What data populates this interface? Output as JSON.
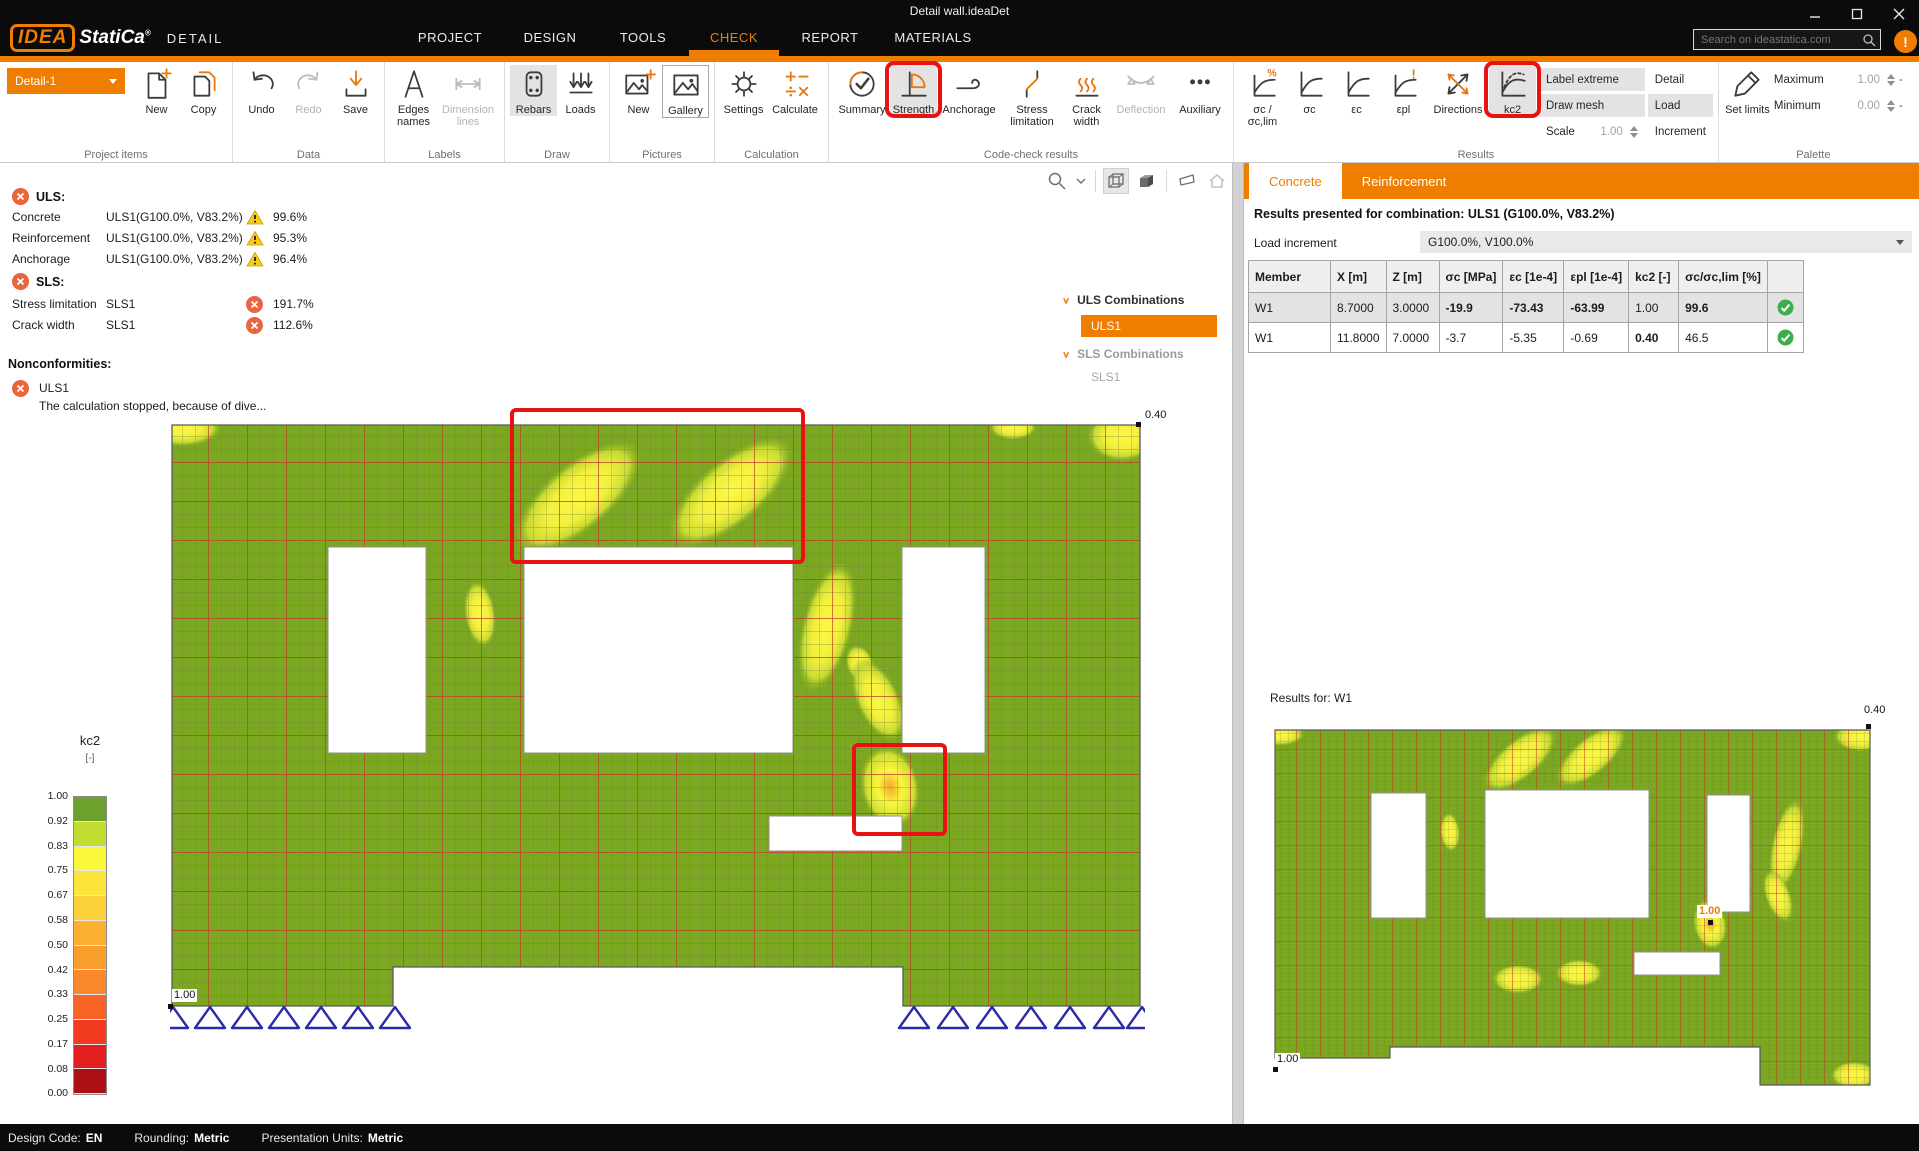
{
  "window": {
    "title": "Detail wall.ideaDet"
  },
  "appbar": {
    "logo_idea": "IDEA",
    "logo_statica": "StatiCa",
    "logo_reg": "®",
    "module": "DETAIL",
    "menus": [
      "PROJECT",
      "DESIGN",
      "TOOLS",
      "CHECK",
      "REPORT",
      "MATERIALS"
    ],
    "search_placeholder": "Search on ideastatica.com",
    "alert": "!"
  },
  "ribbon": {
    "project_combo": "Detail-1",
    "groups": [
      "Project items",
      "Data",
      "Labels",
      "Draw",
      "Pictures",
      "Calculation",
      "Code-check results",
      "Results",
      "Palette"
    ],
    "btn": {
      "new_item": "New",
      "copy": "Copy",
      "undo": "Undo",
      "redo": "Redo",
      "save": "Save",
      "edges_names": "Edges names",
      "dimension_lines": "Dimension lines",
      "rebars": "Rebars",
      "loads": "Loads",
      "new_picture": "New",
      "gallery": "Gallery",
      "settings": "Settings",
      "calculate": "Calculate",
      "summary": "Summary",
      "strength": "Strength",
      "anchorage": "Anchorage",
      "stress_limitation": "Stress limitation",
      "crack_width": "Crack width",
      "deflection": "Deflection",
      "auxiliary": "Auxiliary",
      "sc_sclim": "σc / σc,lim",
      "sc": "σc",
      "ec": "εc",
      "epl": "εpl",
      "directions": "Directions",
      "kc2": "kc2",
      "label_extreme": "Label extreme",
      "draw_mesh": "Draw mesh",
      "scale": "Scale",
      "scale_value": "1.00",
      "detail": "Detail",
      "load": "Load",
      "increment": "Increment",
      "set_limits": "Set limits",
      "maximum": "Maximum",
      "maximum_value": "1.00",
      "minimum": "Minimum",
      "minimum_value": "0.00",
      "spin_dash": "-"
    }
  },
  "summary": {
    "uls_header": "ULS:",
    "uls_rows": [
      {
        "name": "Concrete",
        "combo": "ULS1(G100.0%, V83.2%)",
        "value": "99.6%"
      },
      {
        "name": "Reinforcement",
        "combo": "ULS1(G100.0%, V83.2%)",
        "value": "95.3%"
      },
      {
        "name": "Anchorage",
        "combo": "ULS1(G100.0%, V83.2%)",
        "value": "96.4%"
      }
    ],
    "sls_header": "SLS:",
    "sls_rows": [
      {
        "name": "Stress limitation",
        "combo": "SLS1",
        "value": "191.7%"
      },
      {
        "name": "Crack width",
        "combo": "SLS1",
        "value": "112.6%"
      }
    ],
    "nonconformities_header": "Nonconformities:",
    "nonconformity_item": "ULS1",
    "nonconformity_message": "The calculation stopped, because of dive..."
  },
  "tree": {
    "uls_group": "ULS Combinations",
    "uls_item": "ULS1",
    "sls_group": "SLS Combinations",
    "sls_item": "SLS1"
  },
  "canvas": {
    "label_top_right": "0.40",
    "label_bottom_left": "1.00"
  },
  "legend": {
    "title": "kc2",
    "unit": "[-]",
    "ticks": [
      "1.00",
      "0.92",
      "0.83",
      "0.75",
      "0.67",
      "0.58",
      "0.50",
      "0.42",
      "0.33",
      "0.25",
      "0.17",
      "0.08",
      "0.00"
    ],
    "colors": [
      "#6CA22B",
      "#C3DC32",
      "#FBF73D",
      "#FCE53B",
      "#FCD139",
      "#FBB031",
      "#F99E2D",
      "#F9892B",
      "#F76426",
      "#F23C22",
      "#E31E1E",
      "#AD0F14"
    ]
  },
  "panel": {
    "tabs": [
      "Concrete",
      "Reinforcement"
    ],
    "combo_title": "Results presented for combination: ULS1 (G100.0%, V83.2%)",
    "load_increment_label": "Load increment",
    "load_increment_value": "G100.0%, V100.0%",
    "table": {
      "headers": [
        "Member",
        "X [m]",
        "Z [m]",
        "σc [MPa]",
        "εc [1e-4]",
        "εpl [1e-4]",
        "kc2 [-]",
        "σc/σc,lim [%]"
      ],
      "rows": [
        [
          "W1",
          "8.7000",
          "3.0000",
          "-19.9",
          "-73.43",
          "-63.99",
          "1.00",
          "99.6"
        ],
        [
          "W1",
          "11.8000",
          "7.0000",
          "-3.7",
          "-5.35",
          "-0.69",
          "0.40",
          "46.5"
        ]
      ]
    },
    "results_for": "Results for: W1",
    "mini": {
      "top_right": "0.40",
      "mid": "1.00",
      "bottom_left": "1.00"
    }
  },
  "statusbar": {
    "items": [
      {
        "label": "Design Code:",
        "value": "EN"
      },
      {
        "label": "Rounding:",
        "value": "Metric"
      },
      {
        "label": "Presentation Units:",
        "value": "Metric"
      }
    ]
  }
}
